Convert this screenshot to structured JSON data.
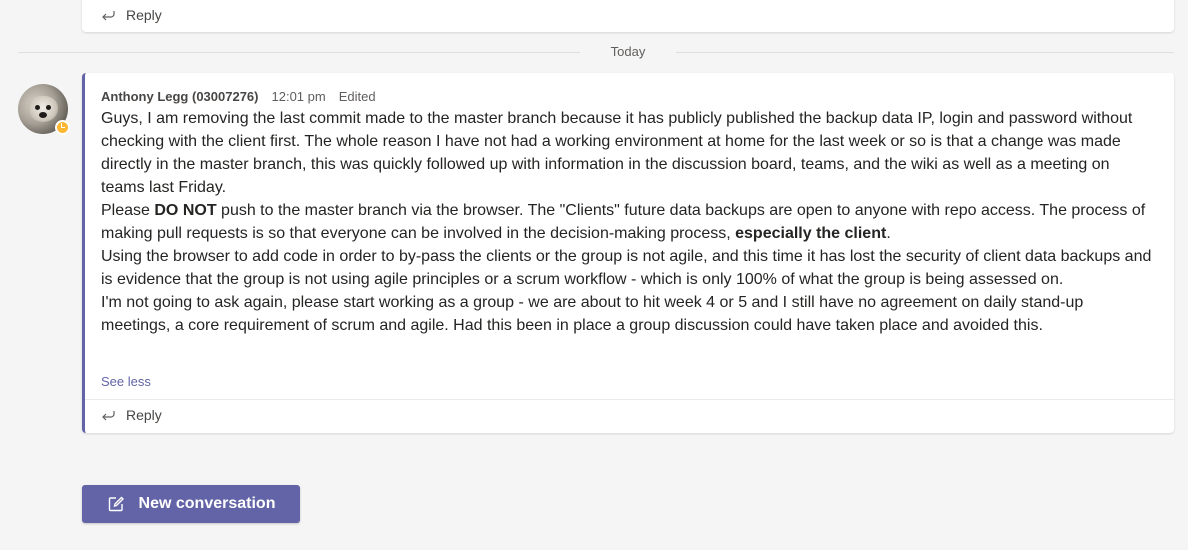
{
  "top_card": {
    "reply_label": "Reply",
    "reply_icon": "reply-arrow-icon"
  },
  "divider": {
    "label": "Today"
  },
  "message": {
    "avatar_icon": "dog-avatar",
    "presence_status": "away",
    "presence_color": "#fcb733",
    "author": "Anthony Legg (03007276)",
    "time": "12:01 pm",
    "edited_label": "Edited",
    "paragraphs": [
      {
        "segments": [
          {
            "text": "Guys, I am removing the last commit made to the master branch because it has publicly published the backup data IP, login and password without checking with the client first. The whole reason I have not had a working environment at home for the last week or so is that a change was made directly in the master branch, this was quickly followed up with information in the discussion board, teams, and the wiki as well as a meeting on teams last Friday.",
            "bold": false
          }
        ]
      },
      {
        "segments": [
          {
            "text": "Please ",
            "bold": false
          },
          {
            "text": "DO NOT",
            "bold": true
          },
          {
            "text": " push to the master branch via the browser. The \"Clients\" future data backups are open to anyone with repo access. The process of making pull requests is so that everyone can be involved in the decision-making process, ",
            "bold": false
          },
          {
            "text": "especially the client",
            "bold": true
          },
          {
            "text": ".",
            "bold": false
          }
        ]
      },
      {
        "segments": [
          {
            "text": "Using the browser to add code in order to by-pass the clients or the group is not agile, and this time it has lost the security of client data backups and is evidence that the group is not using agile principles or a scrum workflow - which is only 100% of what the group is being assessed on.",
            "bold": false
          }
        ]
      },
      {
        "segments": [
          {
            "text": "I'm not going to ask again, please start working as a group - we are about to hit week 4 or 5 and I still have no agreement on daily stand-up meetings, a core requirement of scrum and agile. Had this been in place a group discussion could have taken place and avoided this.",
            "bold": false
          }
        ]
      }
    ],
    "see_less_label": "See less",
    "reply_label": "Reply",
    "reply_icon": "reply-arrow-icon"
  },
  "new_conversation": {
    "label": "New conversation",
    "icon": "compose-icon",
    "color": "#6264a7"
  },
  "colors": {
    "accent": "#6264a7",
    "background": "#f5f5f5",
    "card": "#ffffff"
  }
}
